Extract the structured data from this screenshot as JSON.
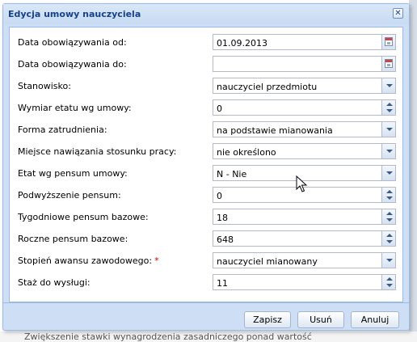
{
  "background": {
    "bottom_text": "Zwiększenie stawki wynagrodzenia zasadniczego ponad wartość"
  },
  "dialog": {
    "title": "Edycja umowy nauczyciela",
    "close_glyph": "✕"
  },
  "form": {
    "fields": [
      {
        "label": "Data obowiązywania od:",
        "value": "01.09.2013",
        "type": "date"
      },
      {
        "label": "Data obowiązywania do:",
        "value": "",
        "type": "date"
      },
      {
        "label": "Stanowisko:",
        "value": "nauczyciel przedmiotu",
        "type": "combo"
      },
      {
        "label": "Wymiar etatu wg umowy:",
        "value": "0",
        "type": "number"
      },
      {
        "label": "Forma zatrudnienia:",
        "value": "na podstawie mianowania",
        "type": "combo"
      },
      {
        "label": "Miejsce nawiązania stosunku pracy:",
        "value": "nie określono",
        "type": "combo"
      },
      {
        "label": "Etat wg pensum umowy:",
        "value": "N - Nie",
        "type": "combo"
      },
      {
        "label": "Podwyższenie pensum:",
        "value": "0",
        "type": "number"
      },
      {
        "label": "Tygodniowe pensum bazowe:",
        "value": "18",
        "type": "number"
      },
      {
        "label": "Roczne pensum bazowe:",
        "value": "648",
        "type": "number"
      },
      {
        "label": "Stopień awansu zawodowego:",
        "value": "nauczyciel mianowany",
        "type": "combo",
        "required_marker": "*"
      },
      {
        "label": "Staż do wysługi:",
        "value": "11",
        "type": "number"
      }
    ]
  },
  "buttons": {
    "save": "Zapisz",
    "delete": "Usuń",
    "cancel": "Anuluj"
  },
  "colors": {
    "title_text": "#15428b",
    "required": "#cc0000",
    "frame": "#cedff5"
  }
}
